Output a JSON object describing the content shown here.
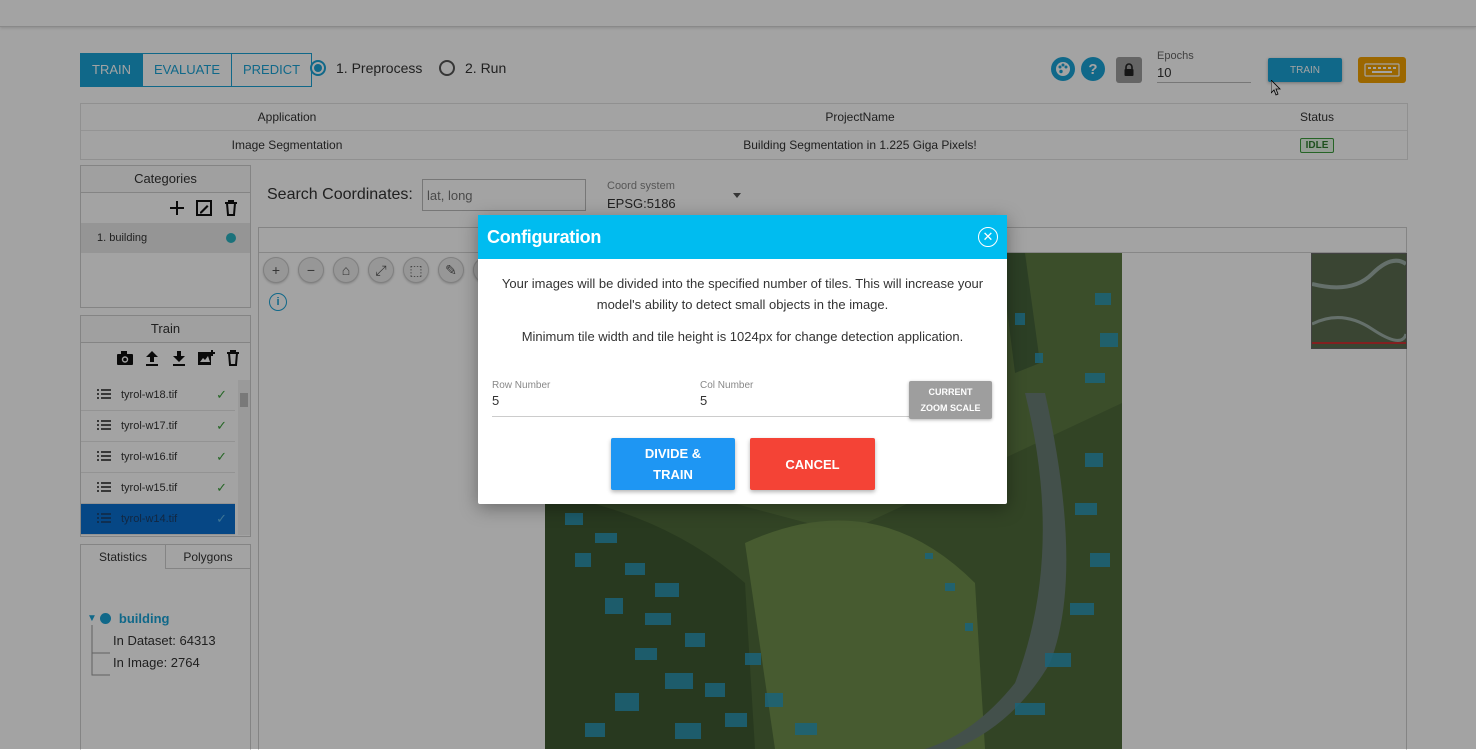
{
  "toolbar": {
    "modes": [
      "TRAIN",
      "EVALUATE",
      "PREDICT"
    ],
    "active_mode": "TRAIN",
    "steps": [
      "1. Preprocess",
      "2. Run"
    ],
    "selected_step": "1. Preprocess",
    "epochs_label": "Epochs",
    "epochs_value": "10",
    "train_label": "TRAIN",
    "icons": [
      "palette-icon",
      "help-icon",
      "lock-icon",
      "keyboard-icon"
    ]
  },
  "project_table": {
    "headers": [
      "Application",
      "ProjectName",
      "Status"
    ],
    "application": "Image Segmentation",
    "project_name": "Building Segmentation in 1.225 Giga Pixels!",
    "status": "IDLE"
  },
  "categories": {
    "title": "Categories",
    "items": [
      {
        "label": "1. building",
        "color": "#2bb3c0"
      }
    ]
  },
  "train_panel": {
    "title": "Train",
    "files": [
      "tyrol-w18.tif",
      "tyrol-w17.tif",
      "tyrol-w16.tif",
      "tyrol-w15.tif",
      "tyrol-w14.tif"
    ],
    "selected_file": "tyrol-w14.tif"
  },
  "stats_panel": {
    "tabs": [
      "Statistics",
      "Polygons"
    ],
    "active_tab": "Statistics",
    "root": "building",
    "children": [
      "In Dataset: 64313",
      "In Image: 2764"
    ]
  },
  "search": {
    "label": "Search Coordinates:",
    "placeholder": "lat, long",
    "coord_label": "Coord system",
    "coord_value": "EPSG:5186"
  },
  "dialog": {
    "title": "Configuration",
    "text1": "Your images will be divided into the specified number of tiles. This will increase your model's ability to detect small objects in the image.",
    "text2": "Minimum tile width and tile height is 1024px for change detection application.",
    "row_label": "Row Number",
    "row_value": "5",
    "col_label": "Col Number",
    "col_value": "5",
    "zoom_line1": "CURRENT",
    "zoom_line2": "ZOOM SCALE",
    "divide_line1": "DIVIDE &",
    "divide_line2": "TRAIN",
    "cancel_label": "CANCEL"
  },
  "colors": {
    "accent": "#1aa3d6",
    "dialog_header": "#00bcf0",
    "primary": "#1e96f3",
    "danger": "#f44336",
    "keyboard": "#f2a100"
  }
}
